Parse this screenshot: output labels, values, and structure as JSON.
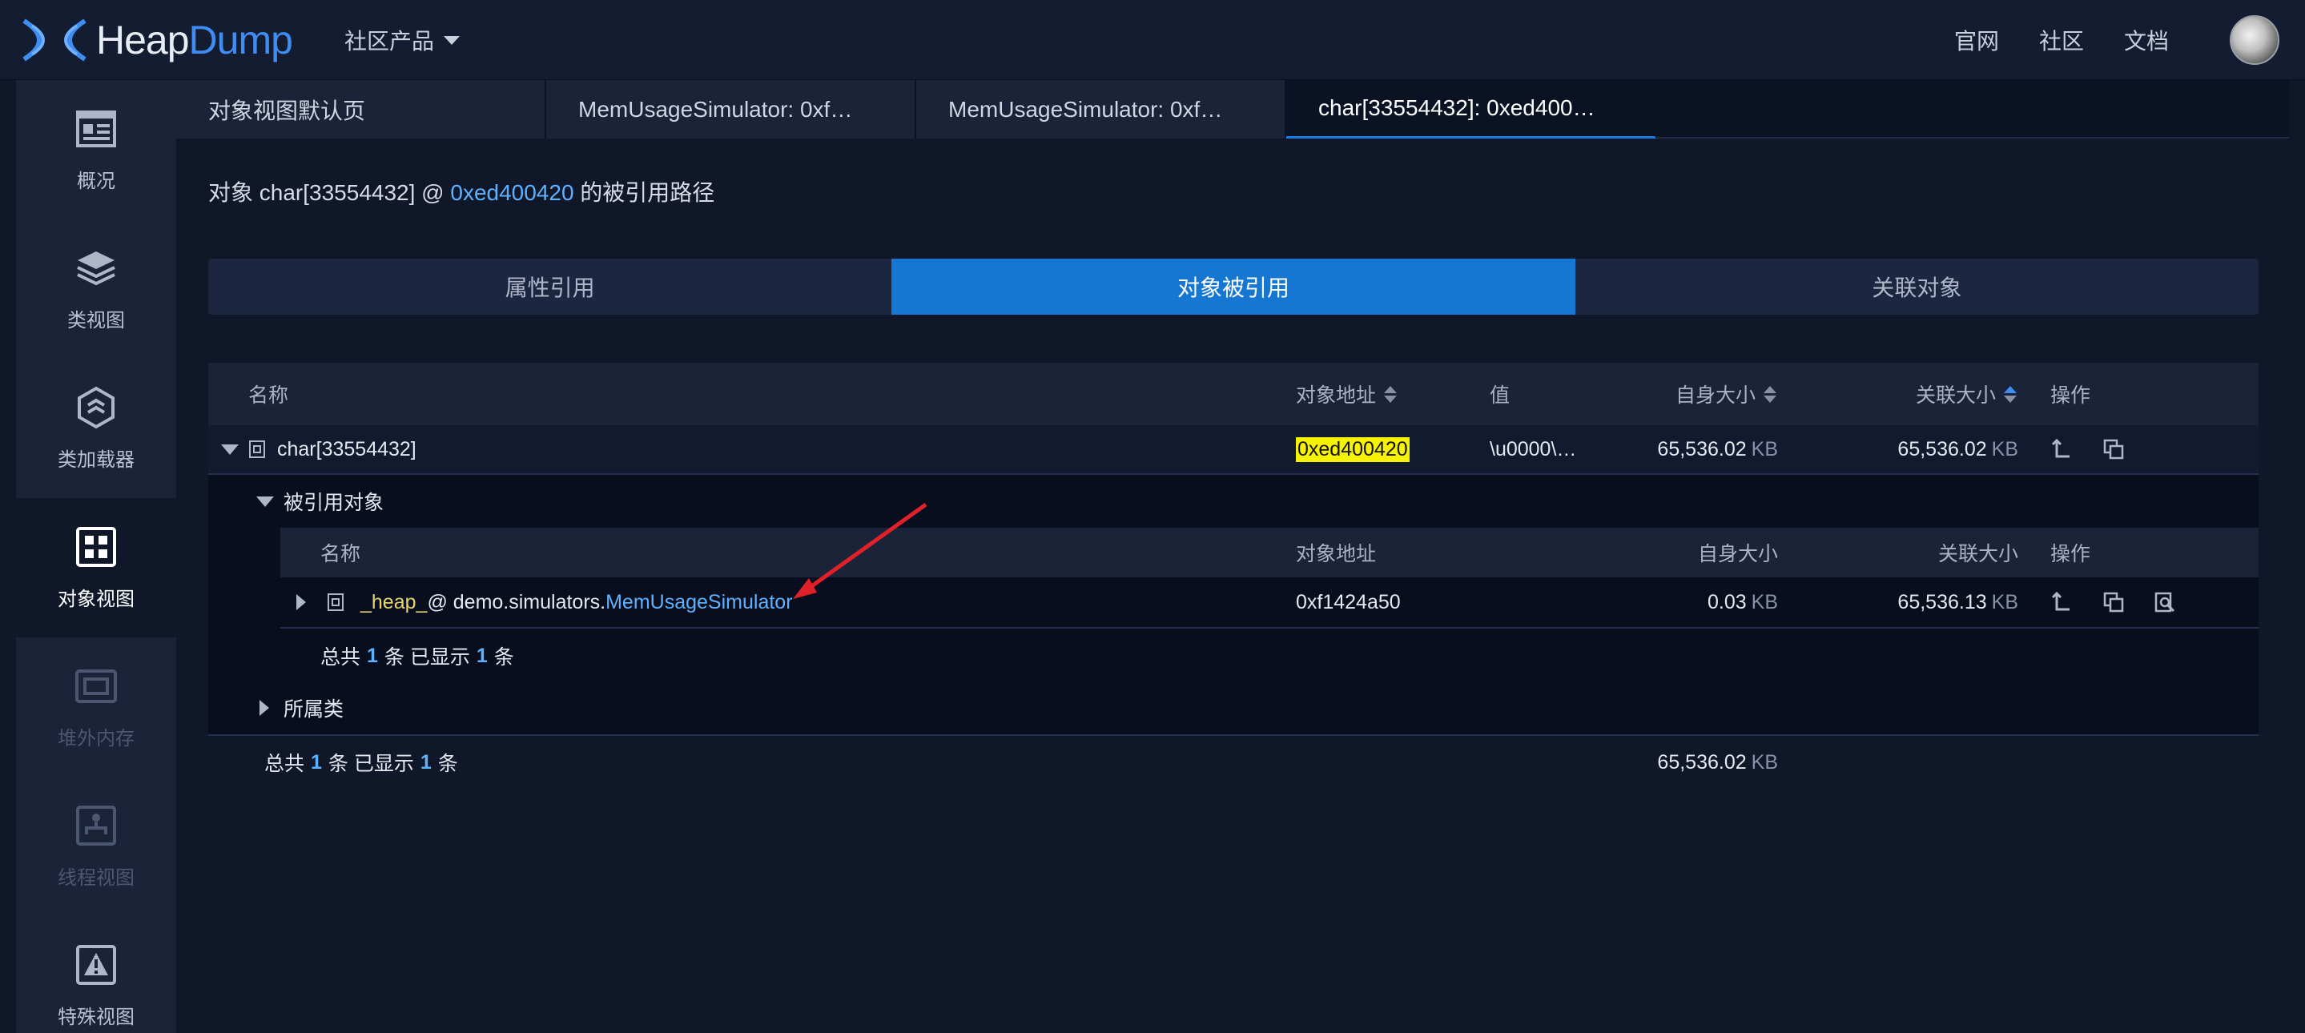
{
  "header": {
    "logo_heap": "Heap",
    "logo_dump": "Dump",
    "product_menu": "社区产品",
    "links": [
      "官网",
      "社区",
      "文档"
    ],
    "icons": {
      "logo": "heapdump-logo-icon",
      "avatar": "user-avatar"
    }
  },
  "sidebar": {
    "items": [
      {
        "label": "概况",
        "icon": "overview-icon",
        "state": "normal"
      },
      {
        "label": "类视图",
        "icon": "layers-icon",
        "state": "normal"
      },
      {
        "label": "类加载器",
        "icon": "classloader-icon",
        "state": "normal"
      },
      {
        "label": "对象视图",
        "icon": "grid-icon",
        "state": "active"
      },
      {
        "label": "堆外内存",
        "icon": "offheap-icon",
        "state": "disabled"
      },
      {
        "label": "线程视图",
        "icon": "thread-icon",
        "state": "disabled"
      },
      {
        "label": "特殊视图",
        "icon": "warning-icon",
        "state": "normal"
      }
    ]
  },
  "tabs": [
    {
      "label": "对象视图默认页",
      "active": false
    },
    {
      "label": "MemUsageSimulator: 0xf…",
      "active": false
    },
    {
      "label": "MemUsageSimulator: 0xf…",
      "active": false
    },
    {
      "label": "char[33554432]: 0xed400…",
      "active": true
    }
  ],
  "title": {
    "prefix": "对象 char[33554432] @ ",
    "address": "0xed400420",
    "suffix": " 的被引用路径"
  },
  "segments": [
    {
      "label": "属性引用",
      "active": false
    },
    {
      "label": "对象被引用",
      "active": true
    },
    {
      "label": "关联对象",
      "active": false
    }
  ],
  "table": {
    "headers": {
      "name": "名称",
      "address": "对象地址",
      "value": "值",
      "shallow": "自身大小",
      "retained": "关联大小",
      "ops": "操作"
    },
    "row": {
      "name": "char[33554432]",
      "address": "0xed400420",
      "value": "\\u0000\\…",
      "shallow": "65,536.02",
      "retained": "65,536.02",
      "unit": "KB"
    },
    "referrers": {
      "section_label": "被引用对象",
      "headers": {
        "name": "名称",
        "address": "对象地址",
        "shallow": "自身大小",
        "retained": "关联大小",
        "ops": "操作"
      },
      "row": {
        "field": "_heap_",
        "at": " @ demo.simulators.",
        "class": "MemUsageSimulator",
        "address": "0xf1424a50",
        "shallow": "0.03",
        "retained": "65,536.13",
        "unit": "KB"
      },
      "total_prefix": "总共",
      "total_count": "1",
      "total_mid": "条  已显示",
      "shown_count": "1",
      "total_suffix": "条"
    },
    "owner_section_label": "所属类",
    "footer": {
      "total_prefix": "总共",
      "total_count": "1",
      "total_mid": "条  已显示",
      "shown_count": "1",
      "total_suffix": "条",
      "shallow_sum": "65,536.02",
      "unit": "KB"
    }
  },
  "colors": {
    "accent": "#1677d2",
    "link": "#5fb1ff",
    "highlight": "#f6f200",
    "annotation_arrow": "#e2202a"
  }
}
